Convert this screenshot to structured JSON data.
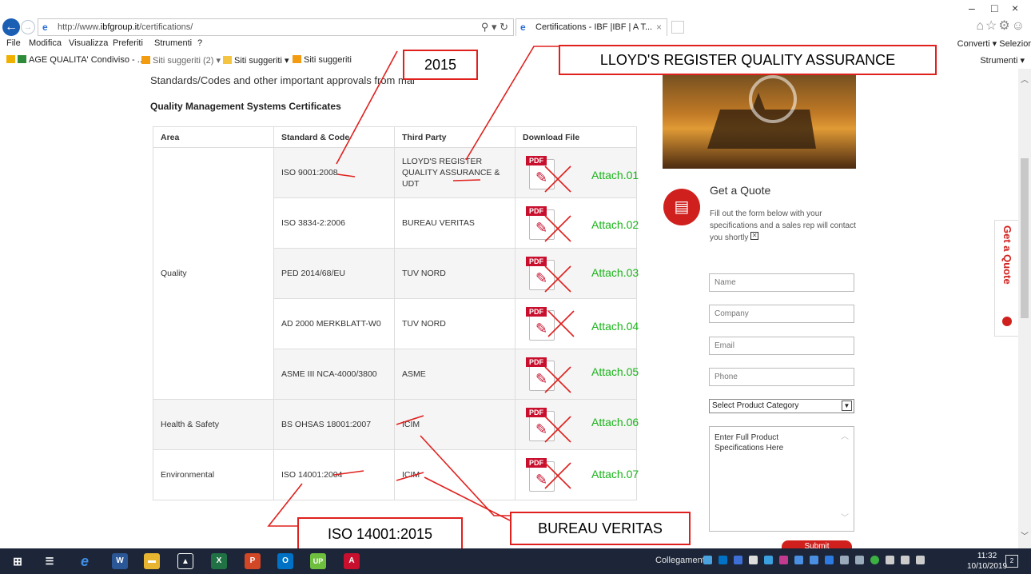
{
  "browser": {
    "url_prefix": "http://www.",
    "url_domain": "ibfgroup.it",
    "url_path": "/certifications/",
    "addr_tools": "⚲ ▾ ↻",
    "tab_title": "Certifications - IBF |IBF | A T...",
    "tab_close": "×",
    "ie_glyph": "e",
    "win_minimize": "–",
    "win_maximize": "□",
    "win_close": "×",
    "right_icons": "⌂☆⚙☺"
  },
  "menu": {
    "items": [
      "File",
      "Modifica",
      "Visualizza",
      "Preferiti",
      "Strumenti",
      "?"
    ],
    "right": "Converti ▾  Selezior"
  },
  "favorites": {
    "items": [
      "AGE QUALITA' Condiviso - ...",
      "Siti suggeriti (2) ▾",
      "Siti suggeriti ▾",
      "Siti suggeriti"
    ],
    "right": "Strumenti ▾"
  },
  "page": {
    "intro": "Standards/Codes and other important approvals from mai",
    "section_title": "Quality Management Systems Certificates",
    "table": {
      "headers": [
        "Area",
        "Standard & Code",
        "Third Party",
        "Download File"
      ],
      "rows": [
        {
          "area": "Quality",
          "standard": "ISO 9001:2008",
          "third_party": "LLOYD'S REGISTER QUALITY ASSURANCE & UDT"
        },
        {
          "area": "",
          "standard": "ISO 3834-2:2006",
          "third_party": "BUREAU VERITAS"
        },
        {
          "area": "",
          "standard": "PED 2014/68/EU",
          "third_party": "TUV NORD"
        },
        {
          "area": "",
          "standard": "AD 2000 MERKBLATT-W0",
          "third_party": "TUV NORD"
        },
        {
          "area": "",
          "standard": "ASME III NCA-4000/3800",
          "third_party": "ASME"
        },
        {
          "area": "Health & Safety",
          "standard": "BS OHSAS 18001:2007",
          "third_party": "ICIM"
        },
        {
          "area": "Environmental",
          "standard": "ISO 14001:2004",
          "third_party": "ICIM"
        }
      ],
      "pdf_label": "PDF"
    }
  },
  "quote": {
    "title": "Get a Quote",
    "desc": "Fill out the form below with your specifications and a sales rep will contact you shortly",
    "xbox": "✕",
    "name_ph": "Name",
    "company_ph": "Company",
    "email_ph": "Email",
    "phone_ph": "Phone",
    "select_value": "Select Product Category",
    "select_arrow": "▼",
    "textarea_ph": "Enter Full Product Specifications Here",
    "submit": "Submit",
    "side_tab": "Get a Quote"
  },
  "annotations": {
    "box_2015": "2015",
    "box_lloyds": "LLOYD'S REGISTER QUALITY ASSURANCE",
    "box_iso": "ISO 14001:2015",
    "box_bv": "BUREAU VERITAS",
    "attach": [
      "Attach.01",
      "Attach.02",
      "Attach.03",
      "Attach.04",
      "Attach.05",
      "Attach.06",
      "Attach.07"
    ],
    "line_color": "#e0201d",
    "attach_color": "#18b418"
  },
  "taskbar": {
    "links": "Collegamenti",
    "time": "11:32",
    "date": "10/10/2019",
    "notif_count": "2"
  }
}
